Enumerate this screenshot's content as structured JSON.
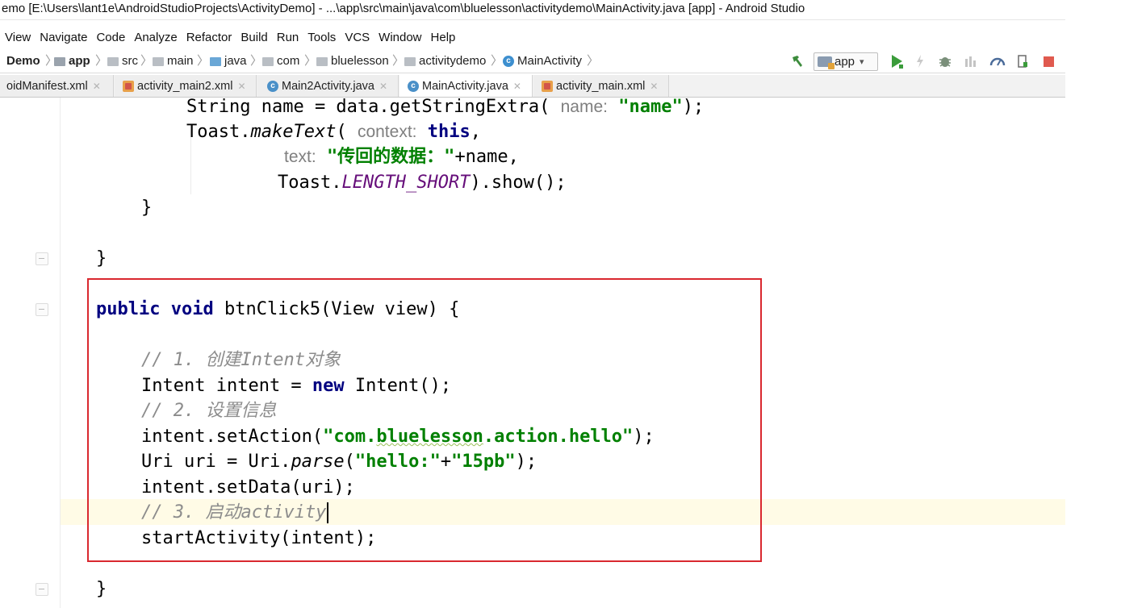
{
  "window": {
    "title": "emo [E:\\Users\\lant1e\\AndroidStudioProjects\\ActivityDemo] - ...\\app\\src\\main\\java\\com\\bluelesson\\activitydemo\\MainActivity.java [app] - Android Studio"
  },
  "menu": [
    "View",
    "Navigate",
    "Code",
    "Analyze",
    "Refactor",
    "Build",
    "Run",
    "Tools",
    "VCS",
    "Window",
    "Help"
  ],
  "breadcrumb": {
    "items": [
      "Demo",
      "app",
      "src",
      "main",
      "java",
      "com",
      "bluelesson",
      "activitydemo",
      "MainActivity"
    ]
  },
  "toolbar": {
    "run_config": "app"
  },
  "tabs": [
    {
      "label": "oidManifest.xml",
      "type": "xml",
      "active": false
    },
    {
      "label": "activity_main2.xml",
      "type": "xml",
      "active": false
    },
    {
      "label": "Main2Activity.java",
      "type": "java",
      "active": false
    },
    {
      "label": "MainActivity.java",
      "type": "java",
      "active": true
    },
    {
      "label": "activity_main.xml",
      "type": "xml",
      "active": false
    }
  ],
  "code": {
    "l1": {
      "pre": "String name = data.getStringExtra( ",
      "hint": "name:",
      "str": "\"name\"",
      "post": ");"
    },
    "l2": {
      "pre": "Toast.",
      "method": "makeText",
      "mid": "( ",
      "hint": "context:",
      "kw": "this",
      "post": ","
    },
    "l3": {
      "hint": "text:",
      "str": "\"传回的数据：\"",
      "post": "+name,"
    },
    "l4": {
      "pre": "Toast.",
      "const": "LENGTH_SHORT",
      "post": ").show();"
    },
    "l5": "}",
    "l6": "}",
    "l7": {
      "kw1": "public",
      "kw2": "void",
      "post": " btnClick5(View view) {"
    },
    "l8": "// 1. 创建Intent对象",
    "l9": {
      "pre": "Intent intent = ",
      "kw": "new",
      "post": " Intent();"
    },
    "l10": "// 2. 设置信息",
    "l11": {
      "pre": "intent.setAction(",
      "str1": "\"com.",
      "squig": "bluelesson",
      "str2": ".action.hello\"",
      "post": ");"
    },
    "l12": {
      "pre": "Uri uri = Uri.",
      "method": "parse",
      "mid": "(",
      "str1": "\"hello:\"",
      "plus": "+",
      "str2": "\"15pb\"",
      "post": ");"
    },
    "l13": "intent.setData(uri);",
    "l14": "// 3. 启动activity",
    "l15": "startActivity(intent);",
    "l16": "}"
  },
  "colors": {
    "keyword": "#000080",
    "string": "#008000",
    "comment": "#8c8c8c",
    "constant": "#660e7a",
    "highlight_box": "#d9282f",
    "caret_line": "#fffbe6"
  }
}
